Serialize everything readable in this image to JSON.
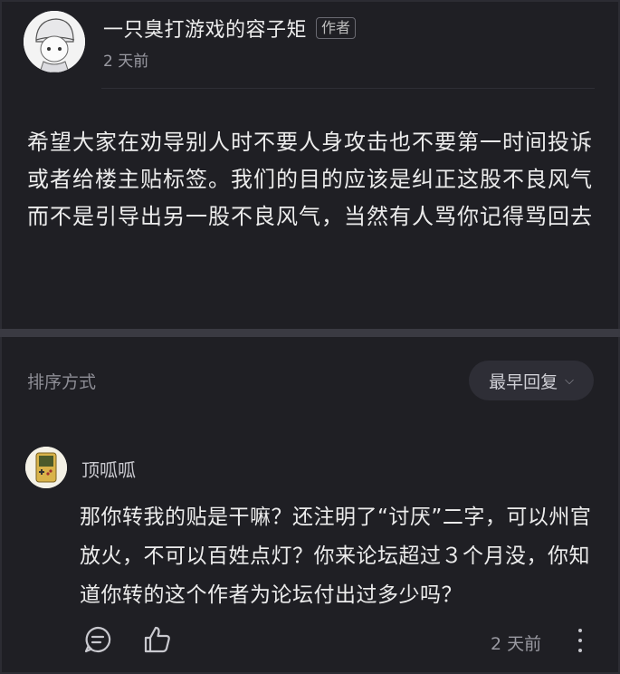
{
  "post": {
    "author_name": "一只臭打游戏的容子矩",
    "author_tag": "作者",
    "time": "2 天前",
    "body": "希望大家在劝导别人时不要人身攻击也不要第一时间投诉或者给楼主贴标签。我们的目的应该是纠正这股不良风气而不是引导出另一股不良风气，当然有人骂你记得骂回去"
  },
  "sort": {
    "label": "排序方式",
    "button_label": "最早回复"
  },
  "comment": {
    "name": "顶呱呱",
    "body": "那你转我的贴是干嘛？还注明了“讨厌”二字，可以州官放火，不可以百姓点灯？你来论坛超过３个月没，你知道你转的这个作者为论坛付出过多少吗？",
    "time": "2 天前"
  },
  "colors": {
    "background": "#1f1f24",
    "divider": "#3a3a42",
    "text": "#ececec",
    "muted": "#9a9aa2"
  }
}
